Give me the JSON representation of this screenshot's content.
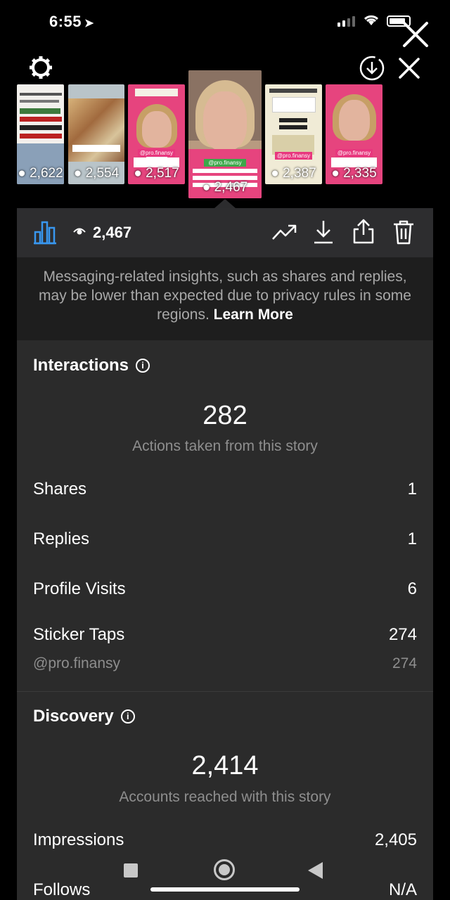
{
  "status_bar": {
    "time": "6:55",
    "location_arrow": "➤"
  },
  "thumbnails": [
    {
      "views": "2,622",
      "style": "text-collage"
    },
    {
      "views": "2,554",
      "style": "building"
    },
    {
      "views": "2,517",
      "style": "girl",
      "handle": "@pro.finansy"
    },
    {
      "views": "2,467",
      "style": "girl-selected",
      "handle": "@pro.finansy",
      "selected": true
    },
    {
      "views": "2,387",
      "style": "text-cream",
      "handle": "@pro.finansy"
    },
    {
      "views": "2,335",
      "style": "girl",
      "handle": "@pro.finansy"
    }
  ],
  "toolbar": {
    "views": "2,467"
  },
  "notice": {
    "text": "Messaging-related insights, such as shares and replies, may be lower than expected due to privacy rules in some regions.",
    "link": "Learn More"
  },
  "interactions": {
    "title": "Interactions",
    "total": "282",
    "caption": "Actions taken from this story",
    "rows": [
      {
        "label": "Shares",
        "value": "1"
      },
      {
        "label": "Replies",
        "value": "1"
      },
      {
        "label": "Profile Visits",
        "value": "6"
      },
      {
        "label": "Sticker Taps",
        "value": "274"
      }
    ],
    "sub_row": {
      "label": "@pro.finansy",
      "value": "274"
    }
  },
  "discovery": {
    "title": "Discovery",
    "total": "2,414",
    "caption": "Accounts reached with this story",
    "rows": [
      {
        "label": "Impressions",
        "value": "2,405"
      },
      {
        "label": "Follows",
        "value": "N/A"
      }
    ]
  },
  "icons": {
    "settings": "gear-icon",
    "download_circle": "download-circle-icon",
    "close": "close-icon",
    "insights": "bar-chart-icon",
    "views": "eye-icon",
    "trend": "trending-up-icon",
    "download": "download-icon",
    "share": "share-icon",
    "delete": "trash-icon",
    "info": "info-icon"
  },
  "colors": {
    "background": "#000000",
    "panel": "#2b2b2b",
    "accent_blue": "#3897f0",
    "pink": "#e8377e"
  }
}
